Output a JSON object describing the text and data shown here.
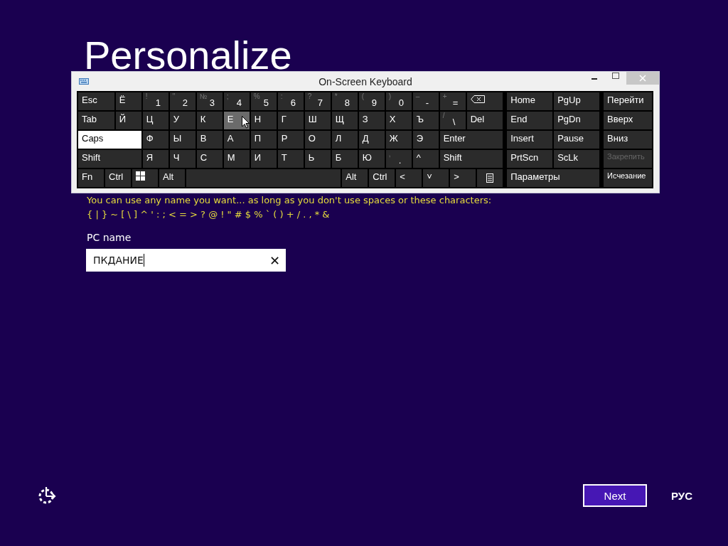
{
  "page": {
    "title": "Personalize",
    "hint": "You can use any name you want... as long as you don't use spaces or these characters:",
    "forbidden": "{ | } ~ [ \\ ] ^ ' : ; < = > ? @ ! \" # $ % ` ( ) + / . , * &",
    "field_label": "PC name",
    "pc_name": {
      "value": "ПКДАНИЕ",
      "clear": "✕"
    }
  },
  "keyboard": {
    "title": "On-Screen Keyboard",
    "main_rows": [
      [
        {
          "kind": "wide",
          "label": "Esc",
          "pressed": false,
          "hovered": false
        },
        {
          "kind": "key",
          "label": "Ё",
          "pressed": false,
          "hovered": false
        },
        {
          "kind": "dual",
          "shift": "!",
          "label": "1",
          "pressed": false,
          "hovered": false
        },
        {
          "kind": "dual",
          "shift": "\"",
          "label": "2",
          "pressed": false,
          "hovered": false
        },
        {
          "kind": "dual",
          "shift": "№",
          "label": "3",
          "pressed": false,
          "hovered": false
        },
        {
          "kind": "dual",
          "shift": ";",
          "label": "4",
          "pressed": false,
          "hovered": false
        },
        {
          "kind": "dual",
          "shift": "%",
          "label": "5",
          "pressed": false,
          "hovered": false
        },
        {
          "kind": "dual",
          "shift": ":",
          "label": "6",
          "pressed": false,
          "hovered": false
        },
        {
          "kind": "dual",
          "shift": "?",
          "label": "7",
          "pressed": false,
          "hovered": false
        },
        {
          "kind": "dual",
          "shift": "*",
          "label": "8",
          "pressed": false,
          "hovered": false
        },
        {
          "kind": "dual",
          "shift": "(",
          "label": "9",
          "pressed": false,
          "hovered": false
        },
        {
          "kind": "dual",
          "shift": ")",
          "label": "0",
          "pressed": false,
          "hovered": false
        },
        {
          "kind": "dual",
          "shift": "–",
          "label": "-",
          "pressed": false,
          "hovered": false
        },
        {
          "kind": "dual",
          "shift": "+",
          "label": "=",
          "pressed": false,
          "hovered": false
        },
        {
          "kind": "backspace",
          "pressed": false,
          "hovered": false
        }
      ],
      [
        {
          "kind": "wide",
          "label": "Tab",
          "pressed": false,
          "hovered": false
        },
        {
          "kind": "key",
          "label": "Й",
          "pressed": false,
          "hovered": false
        },
        {
          "kind": "key",
          "label": "Ц",
          "pressed": false,
          "hovered": false
        },
        {
          "kind": "key",
          "label": "У",
          "pressed": false,
          "hovered": false
        },
        {
          "kind": "key",
          "label": "К",
          "pressed": false,
          "hovered": false
        },
        {
          "kind": "key",
          "label": "Е",
          "pressed": false,
          "hovered": true
        },
        {
          "kind": "key",
          "label": "Н",
          "pressed": false,
          "hovered": false
        },
        {
          "kind": "key",
          "label": "Г",
          "pressed": false,
          "hovered": false
        },
        {
          "kind": "key",
          "label": "Ш",
          "pressed": false,
          "hovered": false
        },
        {
          "kind": "key",
          "label": "Щ",
          "pressed": false,
          "hovered": false
        },
        {
          "kind": "key",
          "label": "З",
          "pressed": false,
          "hovered": false
        },
        {
          "kind": "key",
          "label": "Х",
          "pressed": false,
          "hovered": false
        },
        {
          "kind": "key",
          "label": "Ъ",
          "pressed": false,
          "hovered": false
        },
        {
          "kind": "dual",
          "shift": "/",
          "label": "\\",
          "pressed": false,
          "hovered": false
        },
        {
          "kind": "wide",
          "label": "Del",
          "pressed": false,
          "hovered": false
        }
      ],
      [
        {
          "kind": "wide",
          "label": "Caps",
          "pressed": true,
          "hovered": false
        },
        {
          "kind": "key",
          "label": "Ф",
          "pressed": false,
          "hovered": false
        },
        {
          "kind": "key",
          "label": "Ы",
          "pressed": false,
          "hovered": false
        },
        {
          "kind": "key",
          "label": "В",
          "pressed": false,
          "hovered": false
        },
        {
          "kind": "key",
          "label": "А",
          "pressed": false,
          "hovered": false
        },
        {
          "kind": "key",
          "label": "П",
          "pressed": false,
          "hovered": false
        },
        {
          "kind": "key",
          "label": "Р",
          "pressed": false,
          "hovered": false
        },
        {
          "kind": "key",
          "label": "О",
          "pressed": false,
          "hovered": false
        },
        {
          "kind": "key",
          "label": "Л",
          "pressed": false,
          "hovered": false
        },
        {
          "kind": "key",
          "label": "Д",
          "pressed": false,
          "hovered": false
        },
        {
          "kind": "key",
          "label": "Ж",
          "pressed": false,
          "hovered": false
        },
        {
          "kind": "key",
          "label": "Э",
          "pressed": false,
          "hovered": false
        },
        {
          "kind": "wide",
          "label": "Enter",
          "pressed": false,
          "hovered": false
        }
      ],
      [
        {
          "kind": "wide",
          "label": "Shift",
          "pressed": false,
          "hovered": false
        },
        {
          "kind": "key",
          "label": "Я",
          "pressed": false,
          "hovered": false
        },
        {
          "kind": "key",
          "label": "Ч",
          "pressed": false,
          "hovered": false
        },
        {
          "kind": "key",
          "label": "С",
          "pressed": false,
          "hovered": false
        },
        {
          "kind": "key",
          "label": "М",
          "pressed": false,
          "hovered": false
        },
        {
          "kind": "key",
          "label": "И",
          "pressed": false,
          "hovered": false
        },
        {
          "kind": "key",
          "label": "Т",
          "pressed": false,
          "hovered": false
        },
        {
          "kind": "key",
          "label": "Ь",
          "pressed": false,
          "hovered": false
        },
        {
          "kind": "key",
          "label": "Б",
          "pressed": false,
          "hovered": false
        },
        {
          "kind": "key",
          "label": "Ю",
          "pressed": false,
          "hovered": false
        },
        {
          "kind": "dual",
          "shift": ",",
          "label": ".",
          "pressed": false,
          "hovered": false
        },
        {
          "kind": "key",
          "label": "^",
          "pressed": false,
          "hovered": false
        },
        {
          "kind": "wide",
          "label": "Shift",
          "pressed": false,
          "hovered": false
        }
      ],
      [
        {
          "kind": "key",
          "label": "Fn",
          "pressed": false,
          "hovered": false
        },
        {
          "kind": "key",
          "label": "Ctrl",
          "pressed": false,
          "hovered": false
        },
        {
          "kind": "windows",
          "pressed": false,
          "hovered": false
        },
        {
          "kind": "key",
          "label": "Alt",
          "pressed": false,
          "hovered": false
        },
        {
          "kind": "space",
          "pressed": false,
          "hovered": false
        },
        {
          "kind": "key",
          "label": "Alt",
          "pressed": false,
          "hovered": false
        },
        {
          "kind": "key",
          "label": "Ctrl",
          "pressed": false,
          "hovered": false
        },
        {
          "kind": "key",
          "label": "<",
          "pressed": false,
          "hovered": false
        },
        {
          "kind": "key",
          "label": "˅",
          "pressed": false,
          "hovered": false
        },
        {
          "kind": "key",
          "label": ">",
          "pressed": false,
          "hovered": false
        },
        {
          "kind": "menu",
          "pressed": false,
          "hovered": false
        }
      ]
    ],
    "nav_keys": [
      {
        "label": "Home"
      },
      {
        "label": "PgUp"
      },
      {
        "label": "End"
      },
      {
        "label": "PgDn"
      },
      {
        "label": "Insert"
      },
      {
        "label": "Pause"
      },
      {
        "label": "PrtScn"
      },
      {
        "label": "ScLk"
      },
      {
        "label": "Параметры"
      }
    ],
    "side_keys": [
      {
        "label": "Перейти",
        "disabled": false
      },
      {
        "label": "Вверх",
        "disabled": false
      },
      {
        "label": "Вниз",
        "disabled": false
      },
      {
        "label": "Закрепить",
        "disabled": true
      },
      {
        "label": "Исчезание",
        "disabled": false
      }
    ]
  },
  "footer": {
    "next": "Next",
    "language": "РУС"
  }
}
